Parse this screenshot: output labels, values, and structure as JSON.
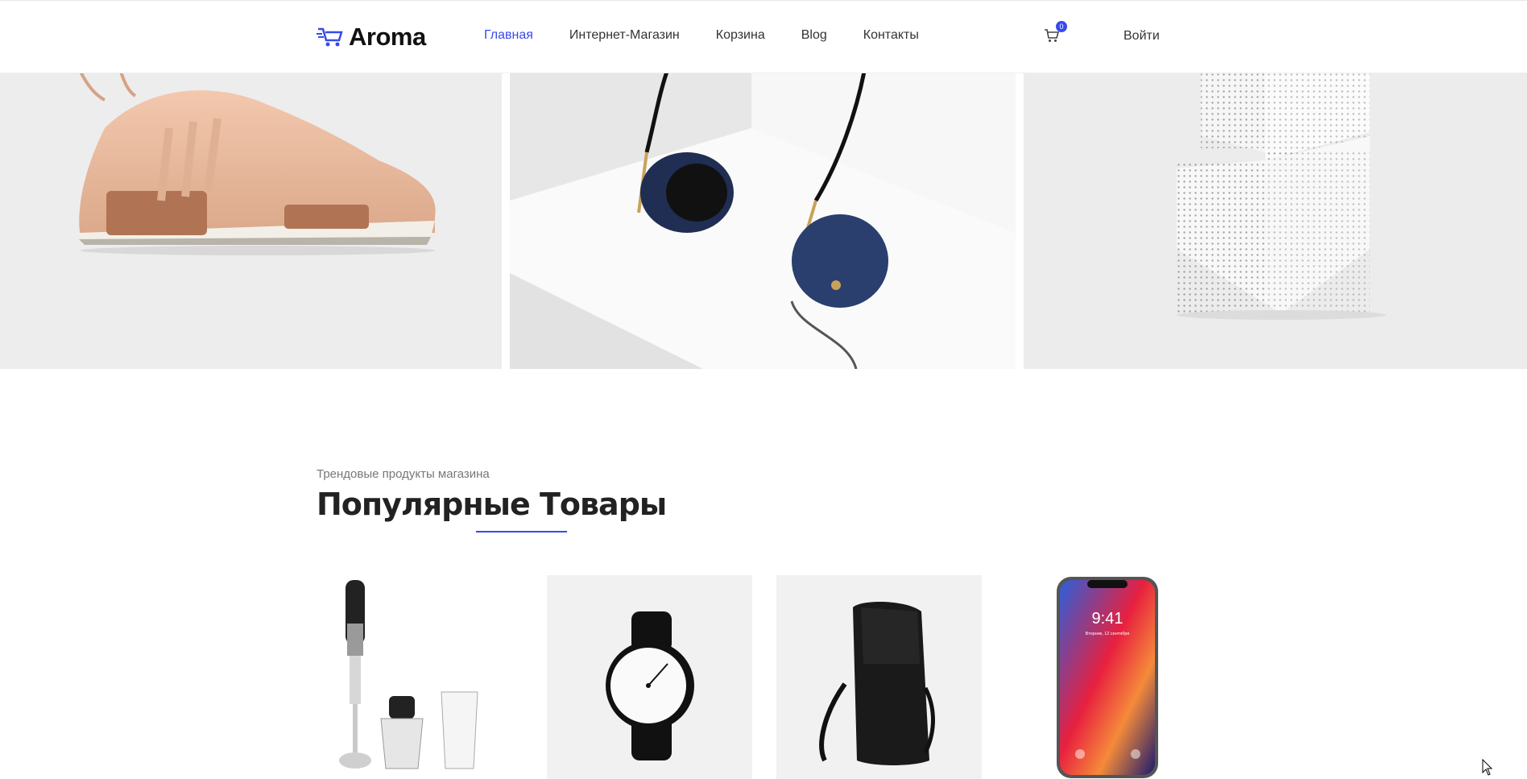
{
  "header": {
    "logo_text": "Aroma",
    "nav": [
      "Главная",
      "Интернет-Магазин",
      "Корзина",
      "Blog",
      "Контакты"
    ],
    "active_nav": "Главная",
    "cart_count": "0",
    "login_label": "Войти"
  },
  "icons": {
    "logo": "cart-logo-icon",
    "cart": "shopping-cart-icon",
    "cursor": "mouse-pointer-icon"
  },
  "colors": {
    "accent": "#384aeb",
    "text": "#333333",
    "muted": "#777777"
  },
  "hero": {
    "tiles": [
      "sneaker",
      "headphones",
      "perforated-cubes"
    ]
  },
  "section": {
    "subtitle": "Трендовые продукты магазина",
    "title": "Популярные Товары"
  },
  "products": [
    "hand-blender",
    "wrist-watch",
    "backpack",
    "smartphone"
  ],
  "phone_screen": {
    "time": "9:41",
    "date": "Вторник, 12 сентября"
  }
}
